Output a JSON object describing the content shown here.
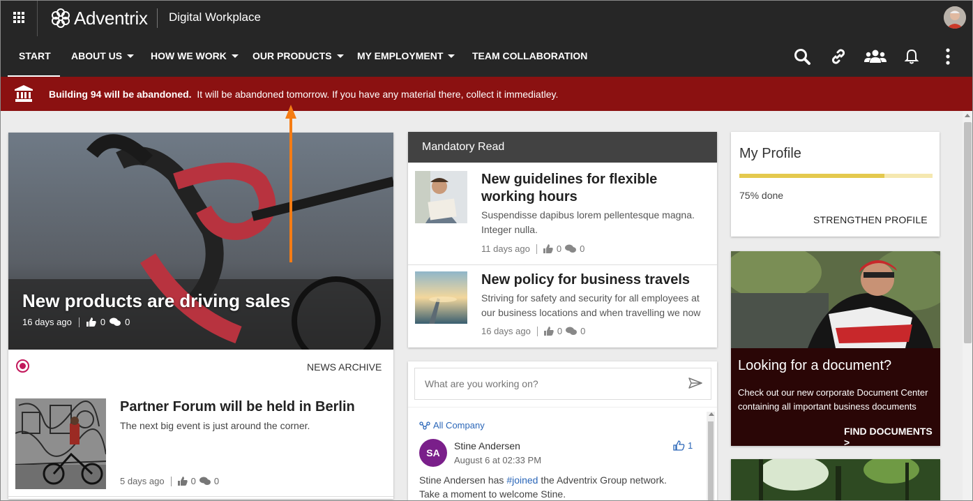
{
  "app": {
    "brand": "Adventrix",
    "title": "Digital Workplace"
  },
  "nav": {
    "items": [
      {
        "label": "START",
        "dropdown": false,
        "active": true
      },
      {
        "label": "ABOUT US",
        "dropdown": true
      },
      {
        "label": "HOW WE WORK",
        "dropdown": true
      },
      {
        "label": "OUR PRODUCTS",
        "dropdown": true
      },
      {
        "label": "MY EMPLOYMENT",
        "dropdown": true
      },
      {
        "label": "TEAM COLLABORATION",
        "dropdown": false
      }
    ],
    "icons": [
      "search-icon",
      "link-icon",
      "people-icon",
      "bell-icon",
      "more-vertical-icon"
    ]
  },
  "alert": {
    "bold": "Building 94 will be abandoned.",
    "text": "It will be abandoned tomorrow. If you have any material there, collect it immediatley.",
    "icon": "building-icon",
    "color": "#8b1111"
  },
  "hero": {
    "title": "New products are driving sales",
    "age": "16 days ago",
    "likes": "0",
    "comments": "0",
    "archive_label": "NEWS ARCHIVE"
  },
  "news": [
    {
      "title": "Partner Forum will be held in Berlin",
      "desc": "The next big event is just around the corner.",
      "age": "5 days ago",
      "likes": "0",
      "comments": "0"
    }
  ],
  "mandatory": {
    "header": "Mandatory Read",
    "articles": [
      {
        "title": "New guidelines for flexible working hours",
        "desc": "Suspendisse dapibus lorem pellentesque magna. Integer nulla.",
        "age": "11 days ago",
        "likes": "0",
        "comments": "0"
      },
      {
        "title": "New policy for business travels",
        "desc": "Striving for safety and security for all employees at our business locations and when travelling we now",
        "age": "16 days ago",
        "likes": "0",
        "comments": "0"
      }
    ]
  },
  "social": {
    "placeholder": "What are you working on?",
    "group": "All Company",
    "post": {
      "initials": "SA",
      "author": "Stine Andersen",
      "date": "August 6 at 02:33 PM",
      "likes": "1",
      "body_pre": "Stine Andersen has ",
      "body_tag": "#joined",
      "body_post": " the Adventrix Group network. Take a moment to welcome Stine."
    }
  },
  "profile": {
    "title": "My Profile",
    "progress_text": "75% done",
    "progress": 0.75,
    "action": "STRENGTHEN PROFILE"
  },
  "documents": {
    "title": "Looking for a document?",
    "desc": "Check out our new corporate Document Center containing all important business documents",
    "link": "FIND DOCUMENTS >"
  }
}
